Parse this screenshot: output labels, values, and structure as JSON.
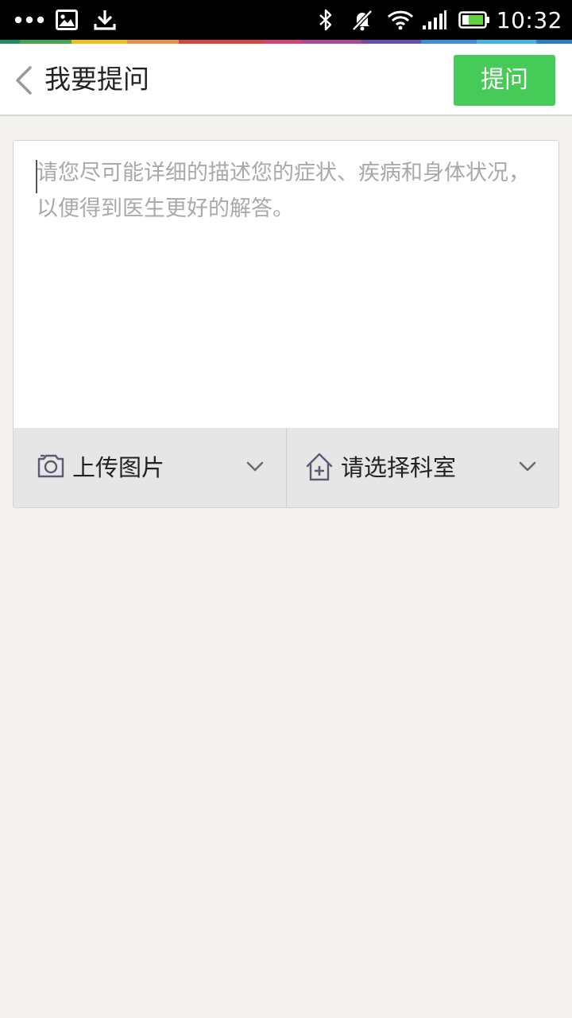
{
  "status_bar": {
    "time": "10:32",
    "icons": [
      "more-dots-icon",
      "image-icon",
      "download-icon",
      "bluetooth-icon",
      "mute-icon",
      "wifi-icon",
      "signal-icon",
      "battery-icon"
    ]
  },
  "header": {
    "title": "我要提问",
    "submit_label": "提问"
  },
  "question": {
    "value": "",
    "placeholder": "请您尽可能详细的描述您的症状、疾病和身体状况，以便得到医生更好的解答。"
  },
  "actions": {
    "upload_label": "上传图片",
    "department_label": "请选择科室"
  },
  "colors": {
    "accent": "#46cb58",
    "background": "#f4f3ef"
  }
}
